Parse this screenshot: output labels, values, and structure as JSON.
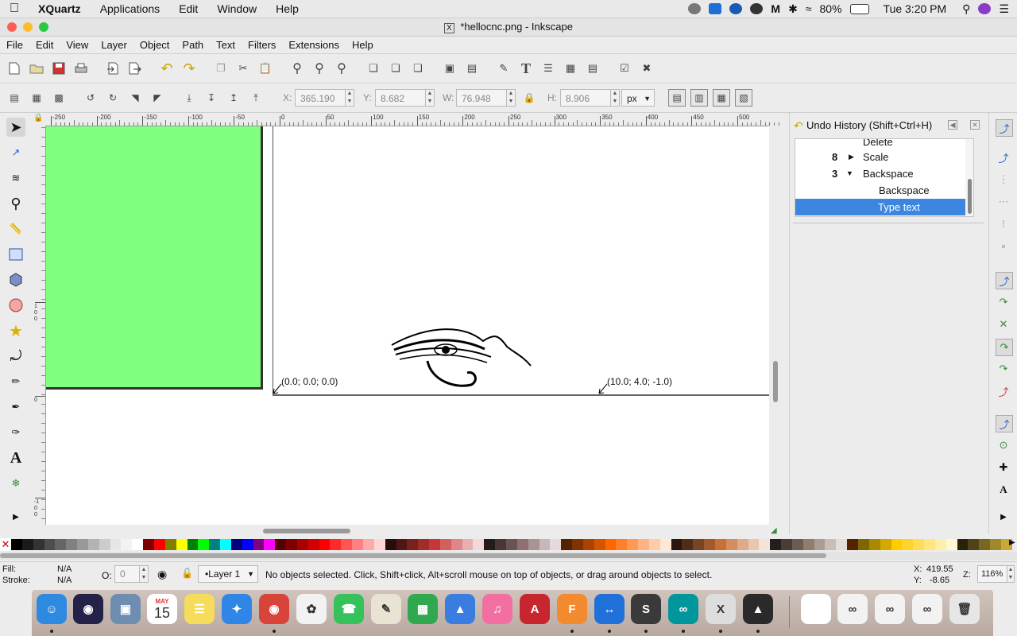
{
  "mac_menubar": {
    "app": "XQuartz",
    "menus": [
      "Applications",
      "Edit",
      "Window",
      "Help"
    ],
    "battery": "80%",
    "clock": "Tue 3:20 PM"
  },
  "window": {
    "title": "*hellocnc.png - Inkscape"
  },
  "app_menu": [
    "File",
    "Edit",
    "View",
    "Layer",
    "Object",
    "Path",
    "Text",
    "Filters",
    "Extensions",
    "Help"
  ],
  "controls": {
    "x_label": "X:",
    "x_value": "365.190",
    "y_label": "Y:",
    "y_value": "8.682",
    "w_label": "W:",
    "w_value": "76.948",
    "h_label": "H:",
    "h_value": "8.906",
    "unit": "px"
  },
  "rulers": {
    "h_ticks": [
      "-250",
      "-200",
      "-150",
      "-100",
      "-50",
      "0",
      "50",
      "100",
      "150",
      "200",
      "250",
      "300",
      "350",
      "400",
      "450",
      "500"
    ],
    "v_ticks": [
      "1\n0\n0",
      "0",
      "-1\n0\n0"
    ]
  },
  "canvas": {
    "label_origin": "(0.0; 0.0; 0.0)",
    "label_point": "(10.0; 4.0; -1.0)",
    "rect_color": "#80ff80"
  },
  "undo_history": {
    "title": "Undo History (Shift+Ctrl+H)",
    "items": [
      {
        "count": "",
        "label": "Delete"
      },
      {
        "count": "8",
        "label": "Scale"
      },
      {
        "count": "3",
        "label": "Backspace"
      },
      {
        "count": "",
        "label": "Backspace"
      },
      {
        "count": "",
        "label": "Type text"
      }
    ],
    "selected_color": "#3d86e0"
  },
  "status": {
    "fill_label": "Fill:",
    "fill_value": "N/A",
    "stroke_label": "Stroke:",
    "stroke_value": "N/A",
    "opacity_label": "O:",
    "opacity_value": "0",
    "layer": "•Layer 1",
    "message": "No objects selected. Click, Shift+click, Alt+scroll mouse on top of objects, or drag around objects to select.",
    "cursor_x_label": "X:",
    "cursor_x": "419.55",
    "cursor_y_label": "Y:",
    "cursor_y": "-8.65",
    "zoom_label": "Z:",
    "zoom": "116%"
  },
  "dock_apps": [
    "finder-icon",
    "siri-icon",
    "preview-icon",
    "calendar-icon",
    "notes-icon",
    "safari-icon",
    "chrome-icon",
    "photos-icon",
    "facetime-icon",
    "textedit-icon",
    "numbers-icon",
    "keynote-icon",
    "itunes-icon",
    "autocad-icon",
    "fusion360-icon",
    "teamviewer-icon",
    "sublime-icon",
    "arduino-icon",
    "xquartz-icon",
    "inkscape-icon",
    "document-icon",
    "arduino-doc-icon",
    "arduino-doc2-icon",
    "arduino-doc3-icon",
    "trash-icon"
  ],
  "calendar": {
    "month": "MAY",
    "day": "15"
  },
  "palette_colors": [
    "#000000",
    "#1a1a1a",
    "#333333",
    "#4d4d4d",
    "#666666",
    "#808080",
    "#999999",
    "#b3b3b3",
    "#cccccc",
    "#e6e6e6",
    "#f2f2f2",
    "#ffffff",
    "#800000",
    "#ff0000",
    "#808000",
    "#ffff00",
    "#008000",
    "#00ff00",
    "#008080",
    "#00ffff",
    "#000080",
    "#0000ff",
    "#800080",
    "#ff00ff",
    "#550000",
    "#800000",
    "#aa0000",
    "#d40000",
    "#ff0000",
    "#ff2a2a",
    "#ff5555",
    "#ff8080",
    "#ffaaaa",
    "#ffd5d5",
    "#280b0b",
    "#501616",
    "#782121",
    "#a02c2c",
    "#c83737",
    "#d35f5f",
    "#de8787",
    "#e9afaf",
    "#f4d7d7",
    "#241c1c",
    "#483737",
    "#6c5353",
    "#916f6f",
    "#ac9393",
    "#c8b7b7",
    "#e3dbdb",
    "#552200",
    "#803300",
    "#aa4400",
    "#d45500",
    "#ff6600",
    "#ff7f2a",
    "#ff9955",
    "#ffb380",
    "#ffccaa",
    "#ffe6d5",
    "#28170b",
    "#502d16",
    "#784421",
    "#a05a2c",
    "#c87137",
    "#d38d5f",
    "#deaa87",
    "#e9c6af",
    "#f4e3d7",
    "#241f1c",
    "#483e37",
    "#6c5d53",
    "#917c6f",
    "#ac9d93",
    "#c8beb7",
    "#e3dedb",
    "#552200",
    "#806600",
    "#aa8800",
    "#d4aa00",
    "#ffcc00",
    "#ffd42a",
    "#ffdd55",
    "#ffe680",
    "#ffeeaa",
    "#fff6d5",
    "#28220b",
    "#504416",
    "#786721",
    "#a0892c",
    "#c8ab37"
  ]
}
